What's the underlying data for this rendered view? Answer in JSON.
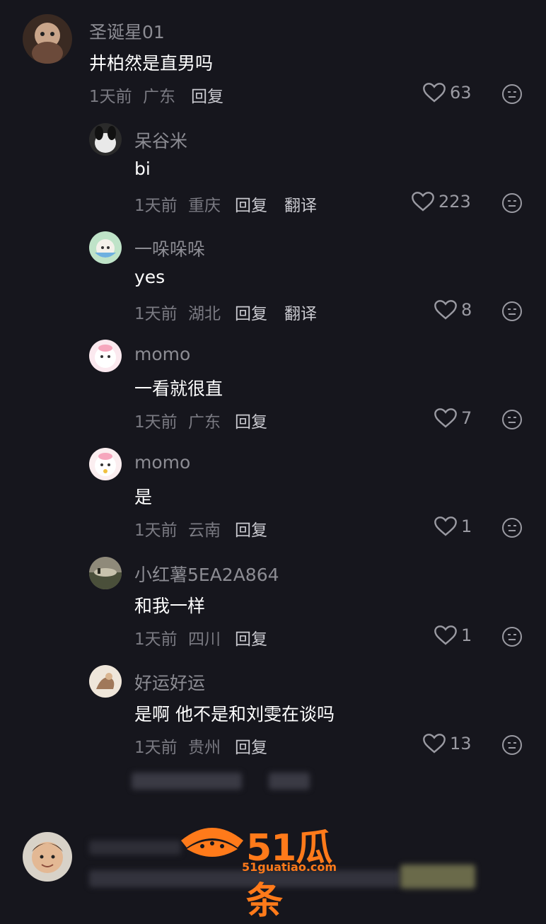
{
  "comments": [
    {
      "user": "圣诞星01",
      "text": "井柏然是直男吗",
      "time": "1天前",
      "loc": "广东",
      "reply": "回复",
      "translate": "",
      "likes": "63"
    },
    {
      "user": "呆谷米",
      "text": "bi",
      "time": "1天前",
      "loc": "重庆",
      "reply": "回复",
      "translate": "翻译",
      "likes": "223"
    },
    {
      "user": "一哚哚哚",
      "text": "yes",
      "time": "1天前",
      "loc": "湖北",
      "reply": "回复",
      "translate": "翻译",
      "likes": "8"
    },
    {
      "user": "momo",
      "text": "一看就很直",
      "time": "1天前",
      "loc": "广东",
      "reply": "回复",
      "translate": "",
      "likes": "7"
    },
    {
      "user": "momo",
      "text": "是",
      "time": "1天前",
      "loc": "云南",
      "reply": "回复",
      "translate": "",
      "likes": "1"
    },
    {
      "user": "小红薯5EA2A864",
      "text": "和我一样",
      "time": "1天前",
      "loc": "四川",
      "reply": "回复",
      "translate": "",
      "likes": "1"
    },
    {
      "user": "好运好运",
      "text": "是啊 他不是和刘雯在谈吗",
      "time": "1天前",
      "loc": "贵州",
      "reply": "回复",
      "translate": "",
      "likes": "13"
    }
  ],
  "watermark": {
    "brand": "51瓜条",
    "url": "51guatiao.com"
  },
  "colors": {
    "background": "#16161d",
    "username": "#8c8c93",
    "text": "#ffffff",
    "meta": "#7a7a82",
    "accent_logo": "#ff7a1a"
  }
}
